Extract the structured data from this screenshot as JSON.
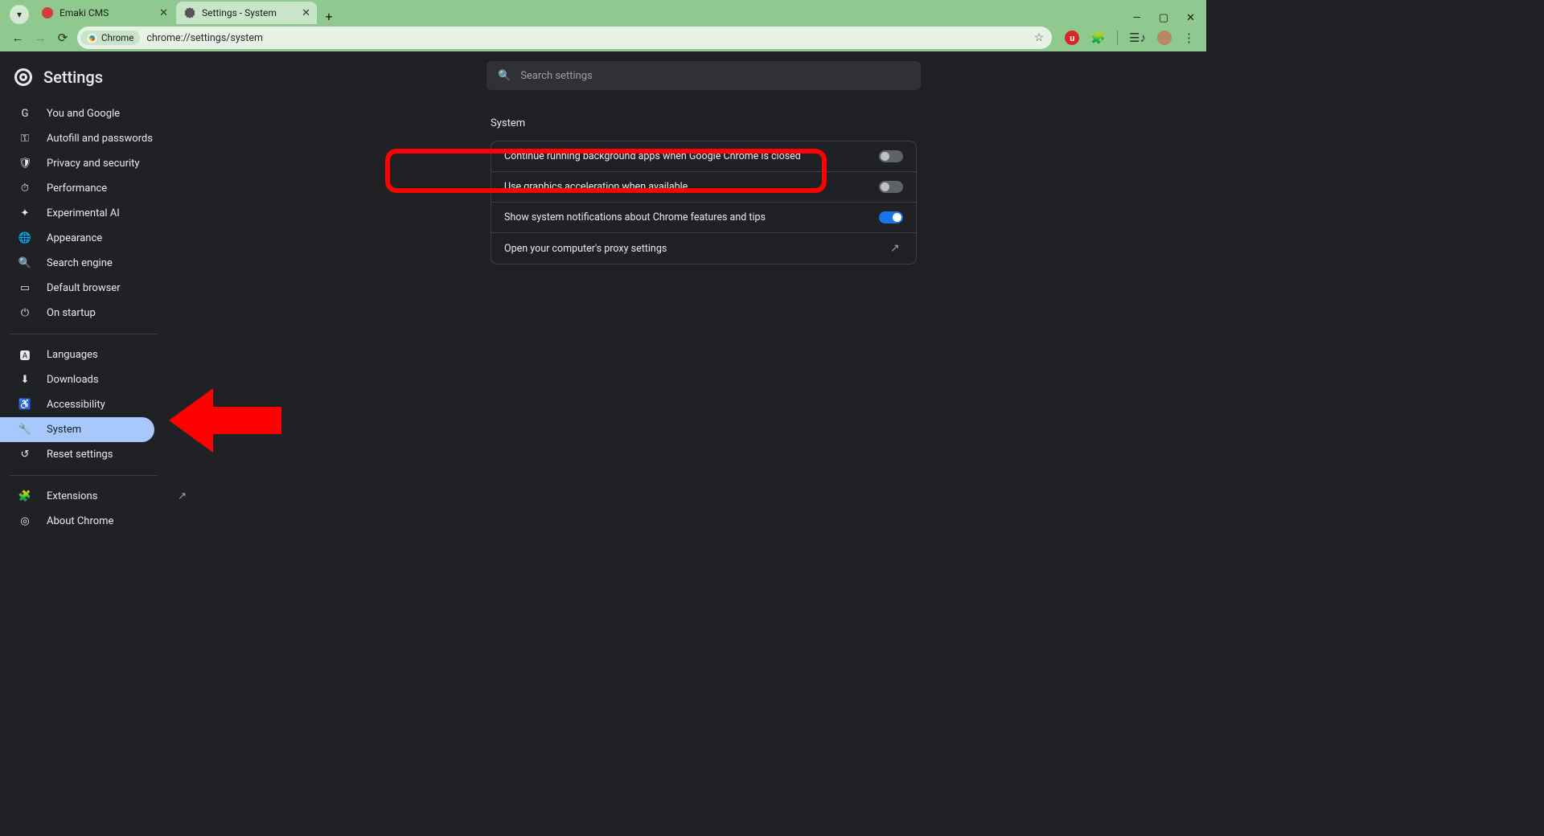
{
  "tabs": [
    {
      "title": "Emaki CMS"
    },
    {
      "title": "Settings - System"
    }
  ],
  "address": {
    "chip": "Chrome",
    "url": "chrome://settings/system"
  },
  "brand": "Settings",
  "search": {
    "placeholder": "Search settings"
  },
  "nav": {
    "group1": [
      {
        "icon": "G",
        "label": "You and Google"
      },
      {
        "icon": "�openid",
        "label": "Autofill and passwords"
      },
      {
        "icon": "🛡",
        "label": "Privacy and security"
      },
      {
        "icon": "⏱",
        "label": "Performance"
      },
      {
        "icon": "✦",
        "label": "Experimental AI"
      },
      {
        "icon": "🌐",
        "label": "Appearance"
      },
      {
        "icon": "🔍",
        "label": "Search engine"
      },
      {
        "icon": "▭",
        "label": "Default browser"
      },
      {
        "icon": "⏻",
        "label": "On startup"
      }
    ],
    "group2": [
      {
        "icon": "🅰",
        "label": "Languages"
      },
      {
        "icon": "⬇",
        "label": "Downloads"
      },
      {
        "icon": "♿",
        "label": "Accessibility"
      },
      {
        "icon": "🔧",
        "label": "System"
      },
      {
        "icon": "↺",
        "label": "Reset settings"
      }
    ],
    "group3": [
      {
        "icon": "🧩",
        "label": "Extensions",
        "external": true
      },
      {
        "icon": "◎",
        "label": "About Chrome"
      }
    ]
  },
  "section": {
    "title": "System",
    "rows": [
      {
        "label": "Continue running background apps when Google Chrome is closed",
        "kind": "toggle",
        "on": false
      },
      {
        "label": "Use graphics acceleration when available",
        "kind": "toggle",
        "on": false
      },
      {
        "label": "Show system notifications about Chrome features and tips",
        "kind": "toggle",
        "on": true
      },
      {
        "label": "Open your computer's proxy settings",
        "kind": "link"
      }
    ]
  },
  "ext_badge": "u"
}
